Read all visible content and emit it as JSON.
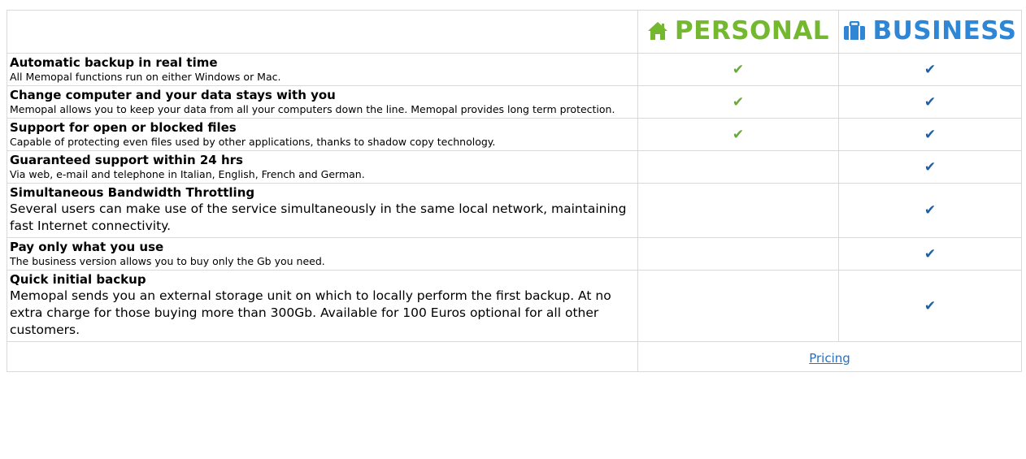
{
  "header": {
    "personal_label": "PERSONAL",
    "business_label": "BUSINESS",
    "personal_icon": "home-icon",
    "business_icon": "briefcase-icon",
    "personal_color": "#73b82f",
    "business_color": "#2e86d4"
  },
  "check_glyph": "✔",
  "features": [
    {
      "title": "Automatic backup in real time",
      "desc": "All Memopal functions run on either Windows or Mac.",
      "personal": true,
      "business": true
    },
    {
      "title": "Change computer and your data stays with you",
      "desc": "Memopal allows you to keep your data from all your computers down the line. Memopal provides long term protection.",
      "personal": true,
      "business": true
    },
    {
      "title": "Support for open or blocked files",
      "desc": "Capable of protecting even files used by other applications, thanks to shadow copy technology.",
      "personal": true,
      "business": true
    },
    {
      "title": "Guaranteed support within 24 hrs",
      "desc": "Via web, e-mail and telephone in Italian, English, French and German.",
      "personal": false,
      "business": true
    },
    {
      "title": "Simultaneous Bandwidth Throttling",
      "desc": "Several users can make use of the service simultaneously in the same local network, maintaining fast Internet connectivity.",
      "personal": false,
      "business": true
    },
    {
      "title": "Pay only what you use",
      "desc": "The business version allows you to buy only the Gb you need.",
      "personal": false,
      "business": true
    },
    {
      "title": "Quick initial backup",
      "desc": "Memopal sends you an external storage unit on which to locally perform the first backup. At no extra charge for those buying more than 300Gb. Available for 100 Euros optional for all other customers.",
      "personal": false,
      "business": true
    }
  ],
  "footer": {
    "pricing_link": "Pricing"
  }
}
